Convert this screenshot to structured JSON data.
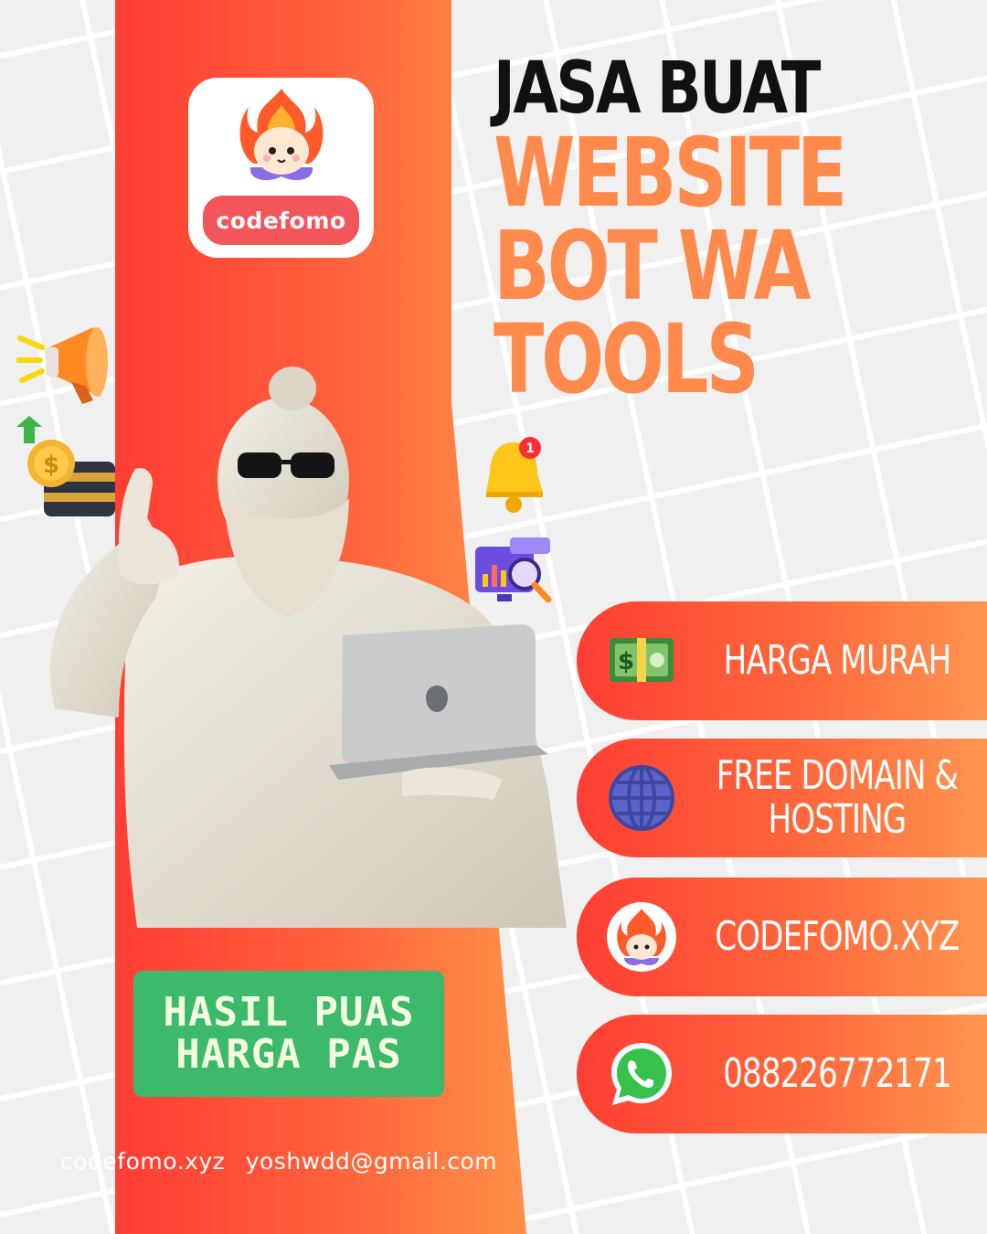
{
  "brand": {
    "logo_text": "codefomo"
  },
  "headline": {
    "line1": "JASA BUAT",
    "services": [
      "WEBSITE",
      "BOT WA",
      "TOOLS"
    ]
  },
  "features": [
    {
      "icon": "money-bill-icon",
      "text": "HARGA MURAH"
    },
    {
      "icon": "globe-icon",
      "text": "FREE DOMAIN & HOSTING"
    },
    {
      "icon": "mascot-icon",
      "text": "CODEFOMO.XYZ"
    },
    {
      "icon": "whatsapp-icon",
      "text": "088226772171"
    }
  ],
  "badge": {
    "line1": "HASIL PUAS",
    "line2": "HARGA PAS"
  },
  "footer": {
    "website": "codefomo.xyz",
    "email": "yoshwdd@gmail.com"
  },
  "colors": {
    "band_red": "#ff3d34",
    "band_orange": "#ff8a45",
    "headline_orange": "#ff8a4c",
    "badge_green": "#3cb96a",
    "logo_pill": "#f2555a"
  }
}
